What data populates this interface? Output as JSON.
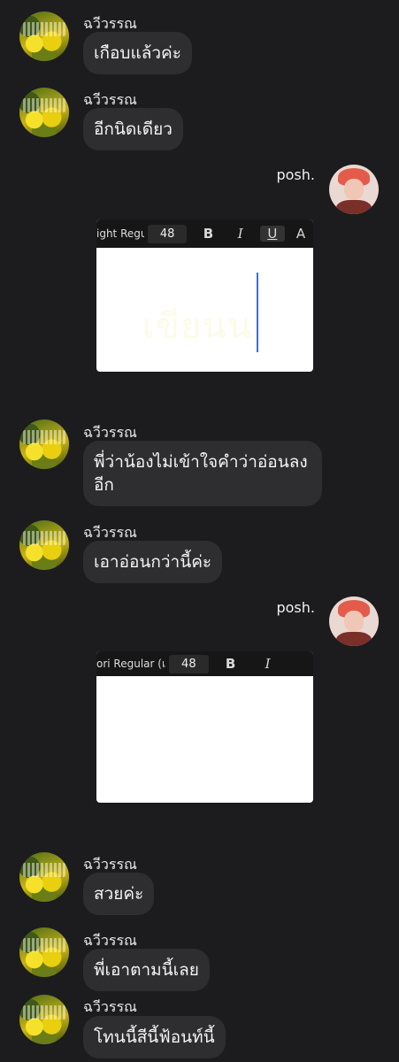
{
  "messages": {
    "m1": {
      "sender": "ฉวีวรรณ",
      "text": "เกือบแล้วค่ะ"
    },
    "m2": {
      "sender": "ฉวีวรรณ",
      "text": "อีกนิดเดียว"
    },
    "p1": {
      "sender": "posh.",
      "toolbar_font": "ight Regu",
      "toolbar_size": "48",
      "bold": "B",
      "italic": "I",
      "underline": "U",
      "more": "A",
      "canvas_text": "เขียนน"
    },
    "m3": {
      "sender": "ฉวีวรรณ",
      "text": "พี่ว่าน้องไม่เข้าใจคำว่าอ่อนลง\nอีก"
    },
    "m4": {
      "sender": "ฉวีวรรณ",
      "text": "เอาอ่อนกว่านี้ค่ะ"
    },
    "p2": {
      "sender": "posh.",
      "toolbar_font": "ori Regular (เ",
      "toolbar_size": "48",
      "bold": "B",
      "italic": "I"
    },
    "m5": {
      "sender": "ฉวีวรรณ",
      "text": "สวยค่ะ"
    },
    "m6": {
      "sender": "ฉวีวรรณ",
      "text": "พี่เอาตามนี้เลย"
    },
    "m7": {
      "sender": "ฉวีวรรณ",
      "text": "โทนนี้สีนี้ฟ้อนท์นี้"
    }
  },
  "colors": {
    "background": "#1c1c1e",
    "bubble": "#2e2e30",
    "cursor": "#3b6fd1",
    "avatar_hair": "#e35b4b"
  }
}
